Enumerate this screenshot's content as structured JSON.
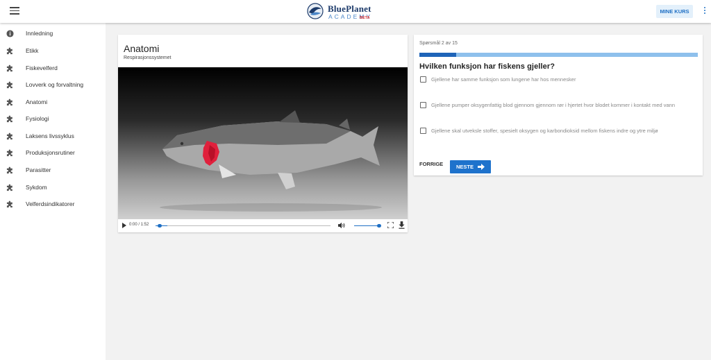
{
  "header": {
    "logo_title": "BluePlanet",
    "logo_subtitle": "ACADEMY",
    "logo_badge": "BETA",
    "mine_kurs_label": "MINE KURS"
  },
  "sidebar": {
    "items": [
      {
        "label": "Innledning",
        "icon": "info-icon"
      },
      {
        "label": "Etikk",
        "icon": "puzzle-icon"
      },
      {
        "label": "Fiskevelferd",
        "icon": "puzzle-icon"
      },
      {
        "label": "Lovverk og forvaltning",
        "icon": "puzzle-icon"
      },
      {
        "label": "Anatomi",
        "icon": "puzzle-icon"
      },
      {
        "label": "Fysiologi",
        "icon": "puzzle-icon"
      },
      {
        "label": "Laksens livssyklus",
        "icon": "puzzle-icon"
      },
      {
        "label": "Produksjonsrutiner",
        "icon": "puzzle-icon"
      },
      {
        "label": "Parasitter",
        "icon": "puzzle-icon"
      },
      {
        "label": "Sykdom",
        "icon": "puzzle-icon"
      },
      {
        "label": "Velferdsindikatorer",
        "icon": "puzzle-icon"
      }
    ]
  },
  "video": {
    "title": "Anatomi",
    "subtitle": "Respirasjonssystemet",
    "time": "0:00 / 1:52",
    "progress": 0.02,
    "volume": 1.0
  },
  "quiz": {
    "counter": "Spørsmål 2 av 15",
    "progress": 0.133,
    "question": "Hvilken funksjon har fiskens gjeller?",
    "options": [
      {
        "label": "Gjellene har samme funksjon som lungene har hos mennesker",
        "checked": false
      },
      {
        "label": "Gjellene pumper oksygenfattig blod gjennom gjennom rør i hjertet hvor blodet kommer i kontakt med vann",
        "checked": false
      },
      {
        "label": "Gjellene skal utveksle stoffer, spesielt oksygen og karbondioksid mellom fiskens indre og ytre miljø",
        "checked": false
      }
    ],
    "prev_label": "FORRIGE",
    "next_label": "NESTE"
  },
  "colors": {
    "accent": "#1e72cc",
    "progress_track": "#8ec0ec",
    "gill": "#e0203c"
  }
}
